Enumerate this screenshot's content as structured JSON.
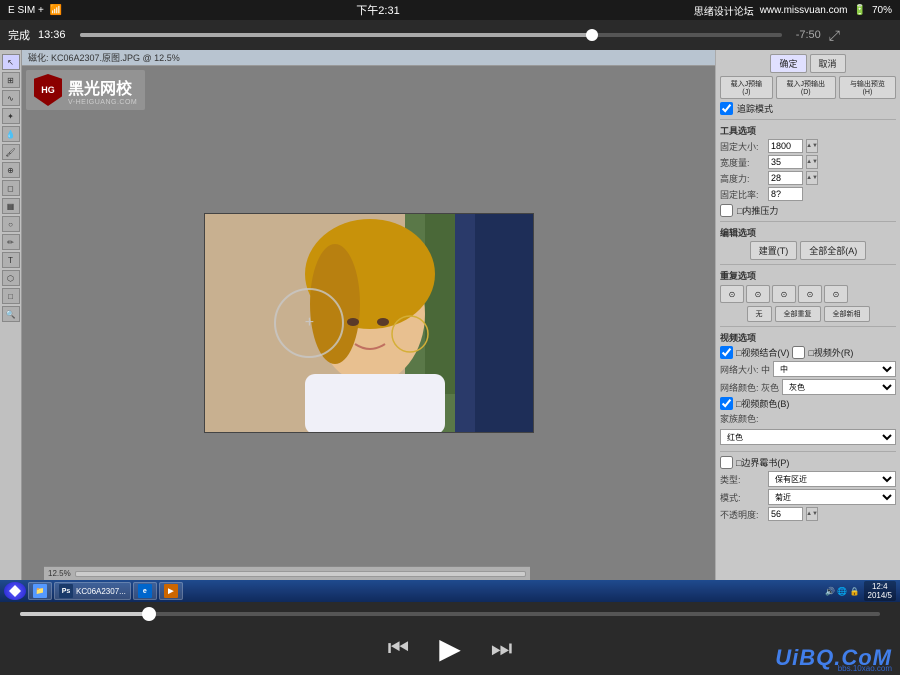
{
  "statusBar": {
    "carrier": "E SIM +",
    "wifi": "WiFi",
    "time": "下午2:31",
    "forumText": "思绪设计论坛",
    "forumUrl": "www.missvuan.com",
    "battery": "70%"
  },
  "videoBar": {
    "doneLabel": "完成",
    "currentTime": "13:36",
    "remainTime": "-7:50",
    "progressPercent": 73
  },
  "canvasTitleBar": {
    "title": "磁化: KC06A2307.原图.JPG @ 12.5%"
  },
  "logo": {
    "hg": "HG",
    "name": "黑光网校",
    "sub": "V-HEIGUANG.COM"
  },
  "rightPanel": {
    "confirmBtn": "确定",
    "cancelBtn": "取消",
    "previewModeLabel": "追踪模式",
    "toolsSection": "工具选项",
    "fixedSizeLabel": "固定大小: 1800",
    "widthLabel": "宽度量: 35",
    "heightLabel": "高度力: 28",
    "fixedRatioLabel": "固定比率: 8?",
    "innerPressureLabel": "□内推压力",
    "paintSection": "编辑选项",
    "buildLabel": "建置(T)",
    "allFullLabel": "全部全部(A)",
    "repeatSection": "重复选项",
    "noneLabel": "无",
    "allRepeatLabel": "全部重复",
    "allNewLabel": "全部新相",
    "videoSection": "视频选项",
    "videoInLabel": "□视频结合(V)",
    "videoOutLabel": "□视频外(R)",
    "netSizeLabel": "网络大小: 中",
    "netColorLabel": "网络颜色: 灰色",
    "videoFixLabel": "□视频颜色(B)",
    "familyColorLabel": "家族颜色:",
    "redColor": "红色",
    "frameSection": "□边界霉书(P)",
    "typeLabel": "类型: 保有区近",
    "modeLabel": "模式: 菊近",
    "opacityLabel": "不透明度: 56",
    "tabs": {
      "previewIn": "载入J预输(J)",
      "previewOut": "载入J预输出(D)",
      "preview3": "与输出预览(H)"
    }
  },
  "taskbar": {
    "items": [
      "PS",
      "KC06A2307...",
      "IE",
      "媒体"
    ]
  },
  "taskbarRight": {
    "time": "12:4",
    "date": "2014/5"
  },
  "bottomControls": {
    "prevLabel": "⏮",
    "playLabel": "▶",
    "nextLabel": "⏭"
  },
  "watermark": {
    "text": "UiBQ.CoM",
    "subText": "bbs.10xao.com"
  }
}
